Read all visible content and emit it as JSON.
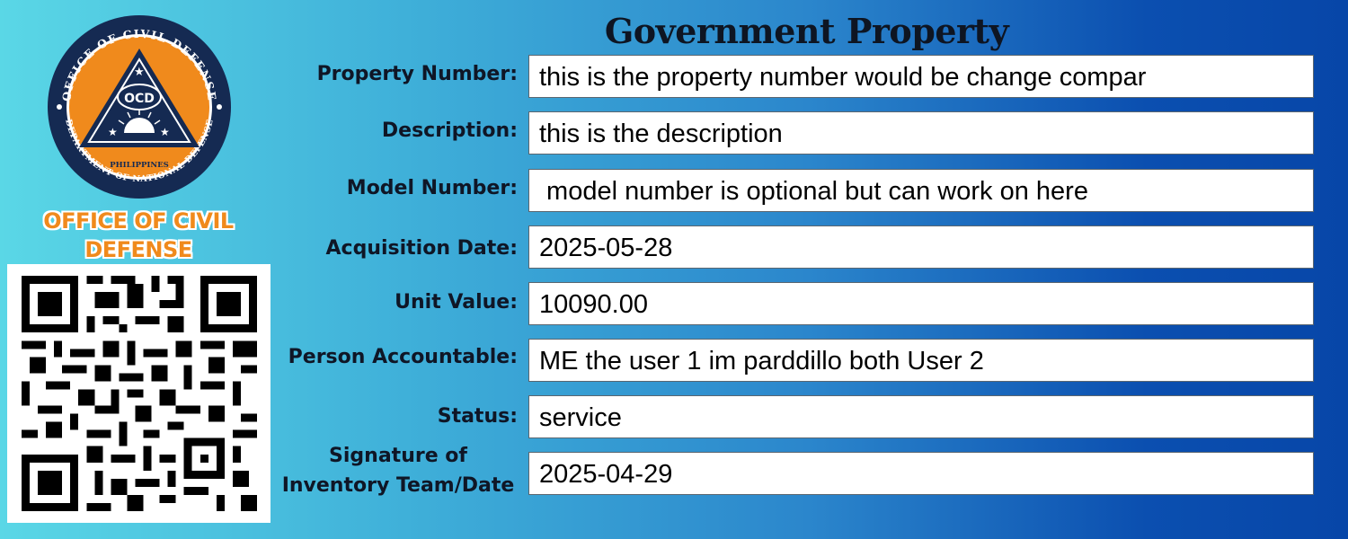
{
  "header": {
    "title": "Government Property"
  },
  "logo": {
    "icon": "ocd-seal-icon",
    "ring_top_text": "OFFICE OF CIVIL DEFENSE",
    "ring_bottom_text": "DEPARTMENT OF NATIONAL DEFENSE",
    "center_text": "OCD",
    "country_text": "PHILIPPINES",
    "colors": {
      "ring": "#152a52",
      "fill": "#f08a1c",
      "triangle": "#152a52"
    }
  },
  "org_name": {
    "line1": "OFFICE OF CIVIL",
    "line2": "DEFENSE"
  },
  "qr": {
    "icon": "qr-code-icon"
  },
  "fields": [
    {
      "label": "Property Number:",
      "value": "this is the property number would be change compar"
    },
    {
      "label": "Description:",
      "value": "this is the description"
    },
    {
      "label": "Model Number:",
      "value": " model number is optional but can work on here"
    },
    {
      "label": "Acquisition Date:",
      "value": "2025-05-28"
    },
    {
      "label": "Unit Value:",
      "value": "10090.00"
    },
    {
      "label": "Person Accountable:",
      "value": "ME the user 1 im parddillo both User 2"
    },
    {
      "label": "Status:",
      "value": "service"
    },
    {
      "label_line1": "Signature of",
      "label_line2": "Inventory Team/Date",
      "value": "2025-04-29"
    }
  ]
}
